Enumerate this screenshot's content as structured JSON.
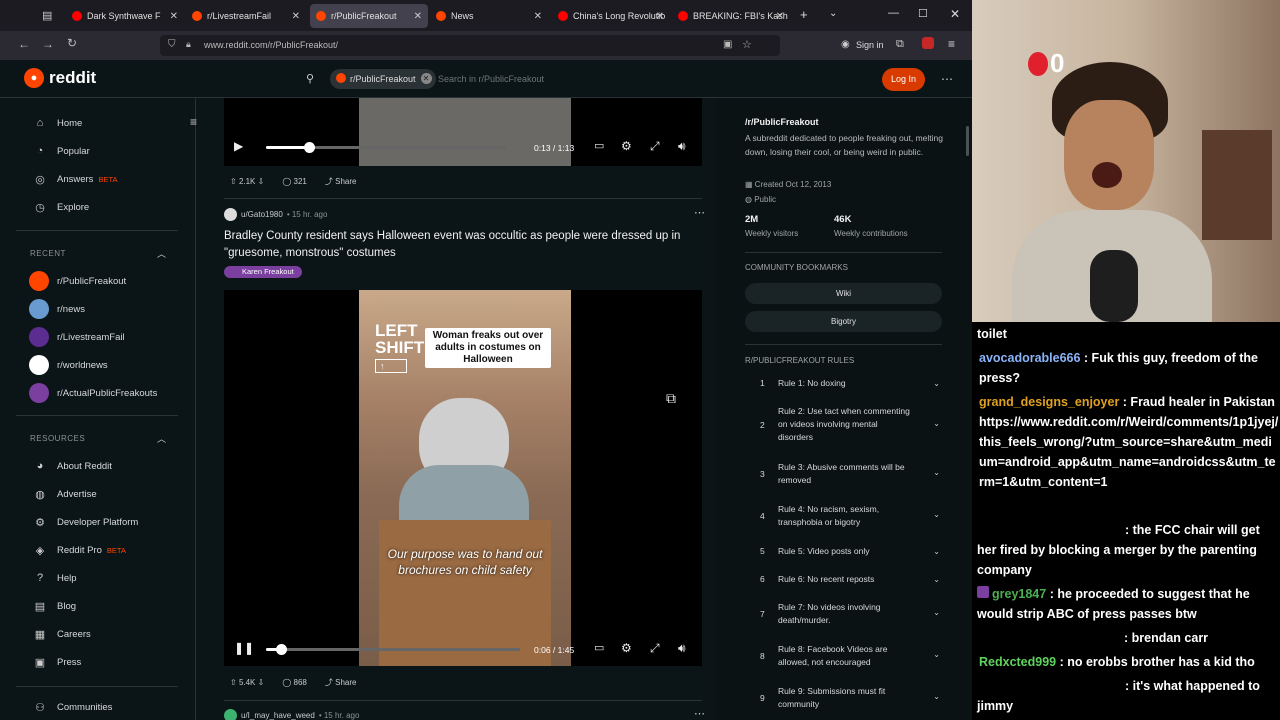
{
  "browser": {
    "tabs": [
      {
        "label": "Dark Synthwave F",
        "color": "#ff0000"
      },
      {
        "label": "r/LivestreamFail",
        "color": "#ff4500"
      },
      {
        "label": "r/PublicFreakout",
        "color": "#ff4500"
      },
      {
        "label": "News",
        "color": "#ff4500"
      },
      {
        "label": "China's Long Revolutio",
        "color": "#ff0000"
      },
      {
        "label": "BREAKING: FBI's Kash",
        "color": "#ff0000"
      }
    ],
    "url": "www.reddit.com/r/PublicFreakout/",
    "sign_in": "Sign in"
  },
  "reddit": {
    "logo": "reddit",
    "search_chip": "r/PublicFreakout",
    "search_placeholder": "Search in r/PublicFreakout",
    "login": "Log In"
  },
  "sidebar": {
    "main": [
      {
        "label": "Home",
        "icon": "home-icon"
      },
      {
        "label": "Popular",
        "icon": "popular-icon"
      },
      {
        "label": "Answers",
        "icon": "answers-icon",
        "badge": "BETA"
      },
      {
        "label": "Explore",
        "icon": "explore-icon"
      }
    ],
    "recent_heading": "RECENT",
    "recent": [
      {
        "label": "r/PublicFreakout",
        "color": "#ff4500"
      },
      {
        "label": "r/news",
        "color": "#6a9bd0"
      },
      {
        "label": "r/LivestreamFail",
        "color": "#5c2d91"
      },
      {
        "label": "r/worldnews",
        "color": "#ffffff"
      },
      {
        "label": "r/ActualPublicFreakouts",
        "color": "#7b3fa0"
      }
    ],
    "resources_heading": "RESOURCES",
    "resources": [
      {
        "label": "About Reddit",
        "icon": "reddit-icon"
      },
      {
        "label": "Advertise",
        "icon": "advertise-icon"
      },
      {
        "label": "Developer Platform",
        "icon": "developer-icon"
      },
      {
        "label": "Reddit Pro",
        "icon": "pro-icon",
        "badge": "BETA"
      },
      {
        "label": "Help",
        "icon": "help-icon"
      },
      {
        "label": "Blog",
        "icon": "blog-icon"
      },
      {
        "label": "Careers",
        "icon": "careers-icon"
      },
      {
        "label": "Press",
        "icon": "press-icon"
      }
    ],
    "communities": "Communities"
  },
  "feed": {
    "post1": {
      "time": "0:13 / 1:13",
      "upvotes": "2.1K",
      "comments": "321",
      "share": "Share",
      "progress": 0.18
    },
    "post2": {
      "user": "u/Gato1980",
      "age": "• 15 hr. ago",
      "title": "Bradley County resident says Halloween event was occultic as people were dressed up in \"gruesome, monstrous\" costumes",
      "flair": "Karen Freakout",
      "video_logo_line1": "LEFT",
      "video_logo_line2": "SHIFT",
      "video_caption_top": "Woman freaks out over adults in costumes on Halloween",
      "video_subtitle": "Our purpose was to hand out brochures on child safety",
      "time": "0:06 / 1:45",
      "progress": 0.06,
      "upvotes": "5.4K",
      "comments": "868",
      "share": "Share"
    },
    "post3": {
      "user": "u/I_may_have_weed",
      "age": "• 15 hr. ago"
    }
  },
  "community": {
    "name": "/r/PublicFreakout",
    "description": "A subreddit dedicated to people freaking out, melting down, losing their cool, or being weird in public.",
    "created": "Created Oct 12, 2013",
    "visibility": "Public",
    "visitors_value": "2M",
    "visitors_label": "Weekly visitors",
    "contrib_value": "46K",
    "contrib_label": "Weekly contributions",
    "bookmarks_heading": "COMMUNITY BOOKMARKS",
    "bookmarks": [
      "Wiki",
      "Bigotry"
    ],
    "rules_heading": "R/PUBLICFREAKOUT RULES",
    "rules": [
      {
        "n": "1",
        "label": "Rule 1: No doxing"
      },
      {
        "n": "2",
        "label": "Rule 2: Use tact when commenting on videos involving mental disorders"
      },
      {
        "n": "3",
        "label": "Rule 3: Abusive comments will be removed"
      },
      {
        "n": "4",
        "label": "Rule 4: No racism, sexism, transphobia or bigotry"
      },
      {
        "n": "5",
        "label": "Rule 5: Video posts only"
      },
      {
        "n": "6",
        "label": "Rule 6: No recent reposts"
      },
      {
        "n": "7",
        "label": "Rule 7: No videos involving death/murder."
      },
      {
        "n": "8",
        "label": "Rule 8: Facebook Videos are allowed, not encouraged"
      },
      {
        "n": "9",
        "label": "Rule 9: Submissions must fit community"
      }
    ]
  },
  "stream": {
    "overlay_count": "0",
    "chat": [
      {
        "user": "",
        "text": "toilet",
        "color": "#ffffff"
      },
      {
        "user": "avocadorable666",
        "text": " : Fuk this guy, freedom of the press?",
        "color": "#8ab4f8"
      },
      {
        "user": "grand_designs_enjoyer",
        "text": " : Fraud healer in Pakistan https://www.reddit.com/r/Weird/comments/1p1jyej/this_feels_wrong/?utm_source=share&utm_medium=android_app&utm_name=androidcss&utm_term=1&utm_content=1",
        "color": "#e0a020"
      },
      {
        "user": "",
        "text": ": the FCC chair will get her fired by blocking a merger by the parenting company",
        "color": "#ffffff"
      },
      {
        "user": "grey1847",
        "text": " : he proceeded to suggest that he would strip ABC of press passes btw",
        "color": "#4caf50"
      },
      {
        "user": "",
        "text": ": brendan carr",
        "color": "#ffffff"
      },
      {
        "user": "Redxcted999",
        "text": " : no erobbs brother has a kid tho",
        "color": "#5fd35f"
      },
      {
        "user": "",
        "text": ": it's what happened to jimmy",
        "color": "#ffffff"
      }
    ]
  }
}
